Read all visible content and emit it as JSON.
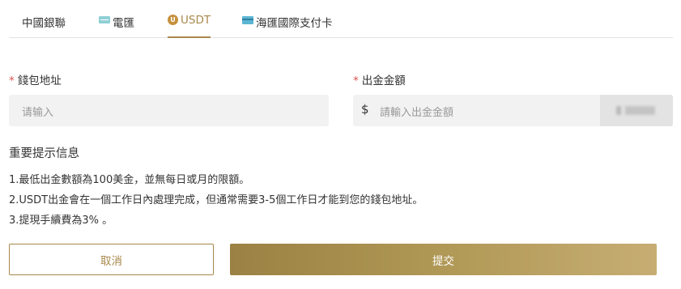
{
  "tabs": [
    {
      "label": "中國銀聯",
      "icon": "unionpay-icon"
    },
    {
      "label": "電匯",
      "icon": "wire-transfer-icon"
    },
    {
      "label": "USDT",
      "icon": "usdt-icon",
      "active": true
    },
    {
      "label": "海匯國際支付卡",
      "icon": "card-icon"
    }
  ],
  "form": {
    "wallet": {
      "required_mark": "*",
      "label": "錢包地址",
      "placeholder": "请输入"
    },
    "amount": {
      "required_mark": "*",
      "label": "出金金額",
      "currency_symbol": "$",
      "placeholder": "請輸入出金金額"
    }
  },
  "info": {
    "title": "重要提示信息",
    "lines": [
      "1.最低出金數額為100美金，並無每日或月的限額。",
      "2.USDT出金會在一個工作日內處理完成，但通常需要3-5個工作日才能到您的錢包地址。",
      "3.提現手續費為3% 。"
    ]
  },
  "buttons": {
    "cancel": "取消",
    "submit": "提交"
  },
  "colors": {
    "accent": "#a8884b",
    "required": "#d9534f",
    "input_bg": "#f2f2f2"
  }
}
